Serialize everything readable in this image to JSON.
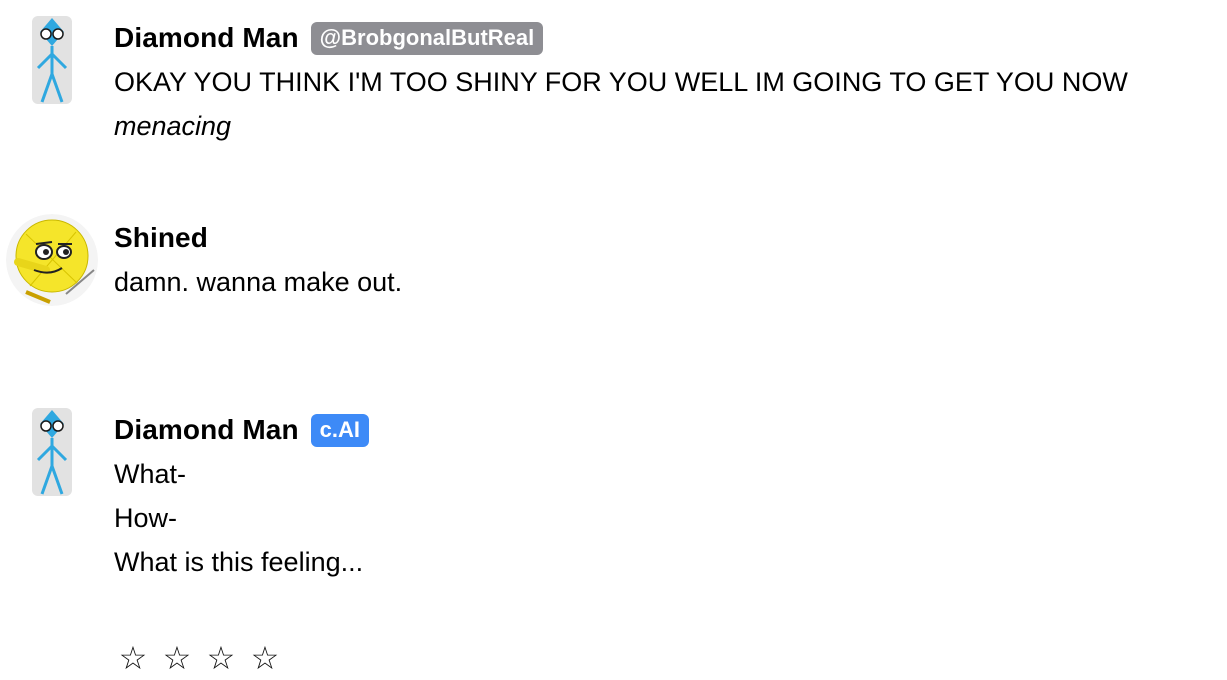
{
  "messages": [
    {
      "author": "Diamond Man",
      "badge": "@BrobgonalButReal",
      "badge_color": "#8e8e93",
      "avatar_icon": "diamond-man-avatar",
      "lines": [
        "OKAY YOU THINK I'M TOO SHINY FOR YOU WELL IM GOING TO GET YOU NOW",
        "menacing"
      ]
    },
    {
      "author": "Shined",
      "avatar_icon": "shined-avatar",
      "lines": [
        "damn. wanna make out."
      ]
    },
    {
      "author": "Diamond Man",
      "badge": "c.AI",
      "badge_color": "#3d8af7",
      "avatar_icon": "diamond-man-avatar",
      "lines": [
        "What-",
        "How-",
        "What is this feeling..."
      ]
    }
  ],
  "rating": {
    "icon": "star-outline-icon",
    "stars": [
      "☆",
      "☆",
      "☆",
      "☆"
    ],
    "value": 0
  }
}
